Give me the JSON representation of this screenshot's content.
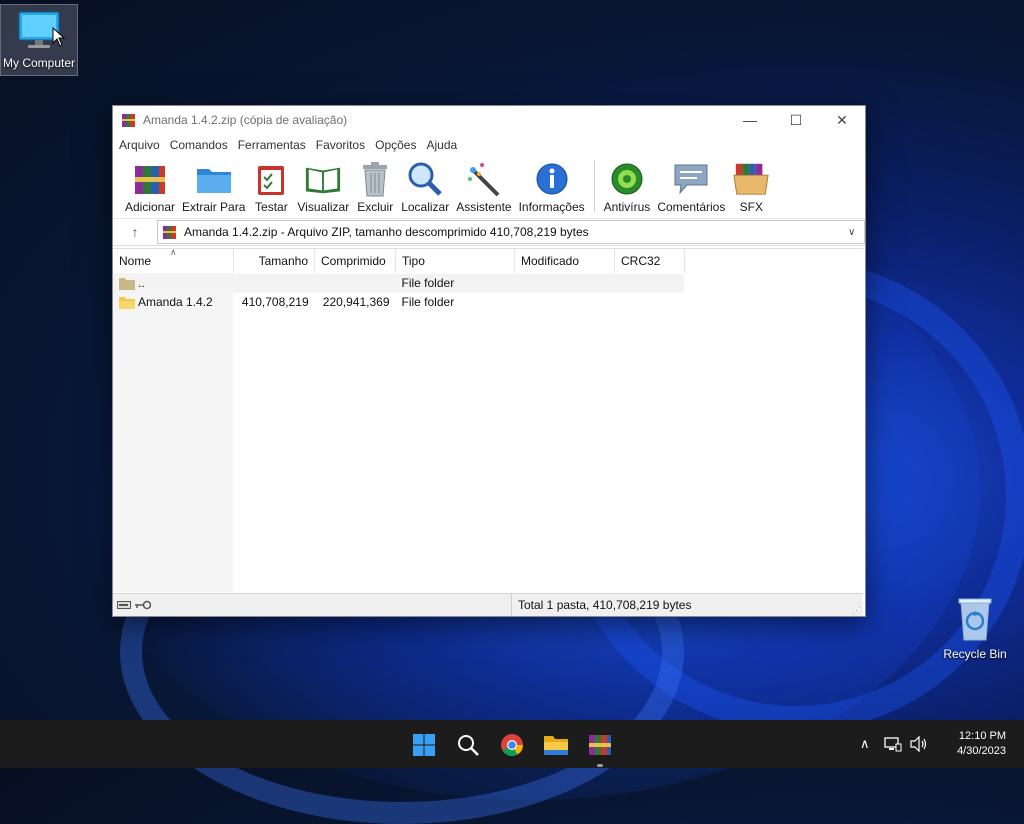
{
  "desktop": {
    "icons": [
      {
        "label": "My Computer"
      },
      {
        "label": "Recycle Bin"
      }
    ]
  },
  "window": {
    "title": "Amanda 1.4.2.zip (cópia de avaliação)",
    "menu": [
      "Arquivo",
      "Comandos",
      "Ferramentas",
      "Favoritos",
      "Opções",
      "Ajuda"
    ],
    "toolbar": [
      {
        "label": "Adicionar",
        "icon": "add-archive-icon"
      },
      {
        "label": "Extrair Para",
        "icon": "extract-folder-icon"
      },
      {
        "label": "Testar",
        "icon": "test-clipboard-icon"
      },
      {
        "label": "Visualizar",
        "icon": "view-book-icon"
      },
      {
        "label": "Excluir",
        "icon": "trash-icon"
      },
      {
        "label": "Localizar",
        "icon": "magnifier-icon"
      },
      {
        "label": "Assistente",
        "icon": "wizard-wand-icon"
      },
      {
        "label": "Informações",
        "icon": "info-icon"
      },
      {
        "label": "Antivírus",
        "icon": "antivirus-bug-icon"
      },
      {
        "label": "Comentários",
        "icon": "comment-icon"
      },
      {
        "label": "SFX",
        "icon": "sfx-box-icon"
      }
    ],
    "address": "Amanda 1.4.2.zip - Arquivo ZIP, tamanho descomprimido 410,708,219 bytes",
    "columns": [
      "Nome",
      "Tamanho",
      "Comprimido",
      "Tipo",
      "Modificado",
      "CRC32"
    ],
    "rows": [
      {
        "name": "..",
        "size": "",
        "packed": "",
        "type": "File folder",
        "modified": "",
        "crc": ""
      },
      {
        "name": "Amanda 1.4.2",
        "size": "410,708,219",
        "packed": "220,941,369",
        "type": "File folder",
        "modified": "",
        "crc": ""
      }
    ],
    "status": "Total 1 pasta, 410,708,219 bytes"
  },
  "taskbar": {
    "apps": [
      "start-icon",
      "search-icon",
      "chrome-icon",
      "file-explorer-icon",
      "winrar-icon"
    ],
    "time": "12:10 PM",
    "date": "4/30/2023"
  },
  "colors": {
    "accent": "#0078d4",
    "folder": "#f2c94c",
    "taskbar": "#1c1c1c"
  }
}
